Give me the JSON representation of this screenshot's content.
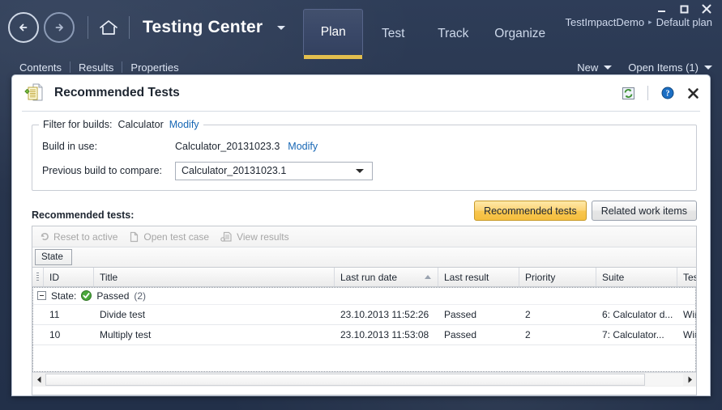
{
  "window": {
    "controls": {
      "minimize": "minimize-icon",
      "maximize": "maximize-icon",
      "close": "close-icon"
    }
  },
  "topnav": {
    "back_icon": "back-arrow-icon",
    "forward_icon": "forward-arrow-icon",
    "home_icon": "home-icon",
    "app_title": "Testing Center",
    "title_dropdown_icon": "chevron-down-icon",
    "tabs": [
      {
        "label": "Plan",
        "active": true
      },
      {
        "label": "Test",
        "active": false
      },
      {
        "label": "Track",
        "active": false
      },
      {
        "label": "Organize",
        "active": false
      }
    ],
    "breadcrumb": {
      "project": "TestImpactDemo",
      "separator": "▸",
      "plan": "Default plan"
    }
  },
  "subnav": {
    "links": [
      "Contents",
      "Results",
      "Properties"
    ],
    "new_label": "New",
    "open_items_label": "Open Items (1)"
  },
  "document": {
    "icon": "recommended-tests-document-icon",
    "title": "Recommended Tests",
    "refresh_icon": "refresh-icon",
    "help_icon": "help-icon",
    "close_icon": "close-icon"
  },
  "filter": {
    "legend_label": "Filter for builds:",
    "legend_value": "Calculator",
    "legend_modify": "Modify",
    "build_in_use_label": "Build in use:",
    "build_in_use_value": "Calculator_20131023.3",
    "build_in_use_modify": "Modify",
    "previous_build_label": "Previous build to compare:",
    "previous_build_value": "Calculator_20131023.1",
    "previous_build_caret": "chevron-down-icon"
  },
  "recommended": {
    "section_label": "Recommended tests:",
    "pills": [
      {
        "label": "Recommended tests",
        "selected": true
      },
      {
        "label": "Related work items",
        "selected": false
      }
    ],
    "toolbar": [
      {
        "label": "Reset to active",
        "icon": "undo-icon",
        "enabled": false
      },
      {
        "label": "Open test case",
        "icon": "open-document-icon",
        "enabled": false
      },
      {
        "label": "View results",
        "icon": "view-results-icon",
        "enabled": false
      }
    ],
    "groupby_chip": "State",
    "columns": [
      {
        "label": "ID",
        "sort": ""
      },
      {
        "label": "Title",
        "sort": ""
      },
      {
        "label": "Last run date",
        "sort": "asc"
      },
      {
        "label": "Last result",
        "sort": ""
      },
      {
        "label": "Priority",
        "sort": ""
      },
      {
        "label": "Suite",
        "sort": ""
      },
      {
        "label": "Test co",
        "sort": ""
      }
    ],
    "group": {
      "field_label": "State:",
      "value": "Passed",
      "count": "(2)",
      "status_icon": "passed-check-icon",
      "expander_icon": "collapse-icon"
    },
    "rows": [
      {
        "id": "11",
        "title": "Divide test",
        "last_run_date": "23.10.2013 11:52:26",
        "last_result": "Passed",
        "priority": "2",
        "suite": "6: Calculator d...",
        "test_config": "Window"
      },
      {
        "id": "10",
        "title": "Multiply test",
        "last_run_date": "23.10.2013 11:53:08",
        "last_result": "Passed",
        "priority": "2",
        "suite": "7: Calculator...",
        "test_config": "Window"
      }
    ],
    "hscroll": {
      "left_arrow": "scroll-left-icon",
      "right_arrow": "scroll-right-icon"
    }
  },
  "colors": {
    "accent_gold": "#e3bf4e",
    "link_blue": "#1767b5",
    "chrome_dark": "#2e3d58",
    "pass_green": "#3a9a32"
  }
}
